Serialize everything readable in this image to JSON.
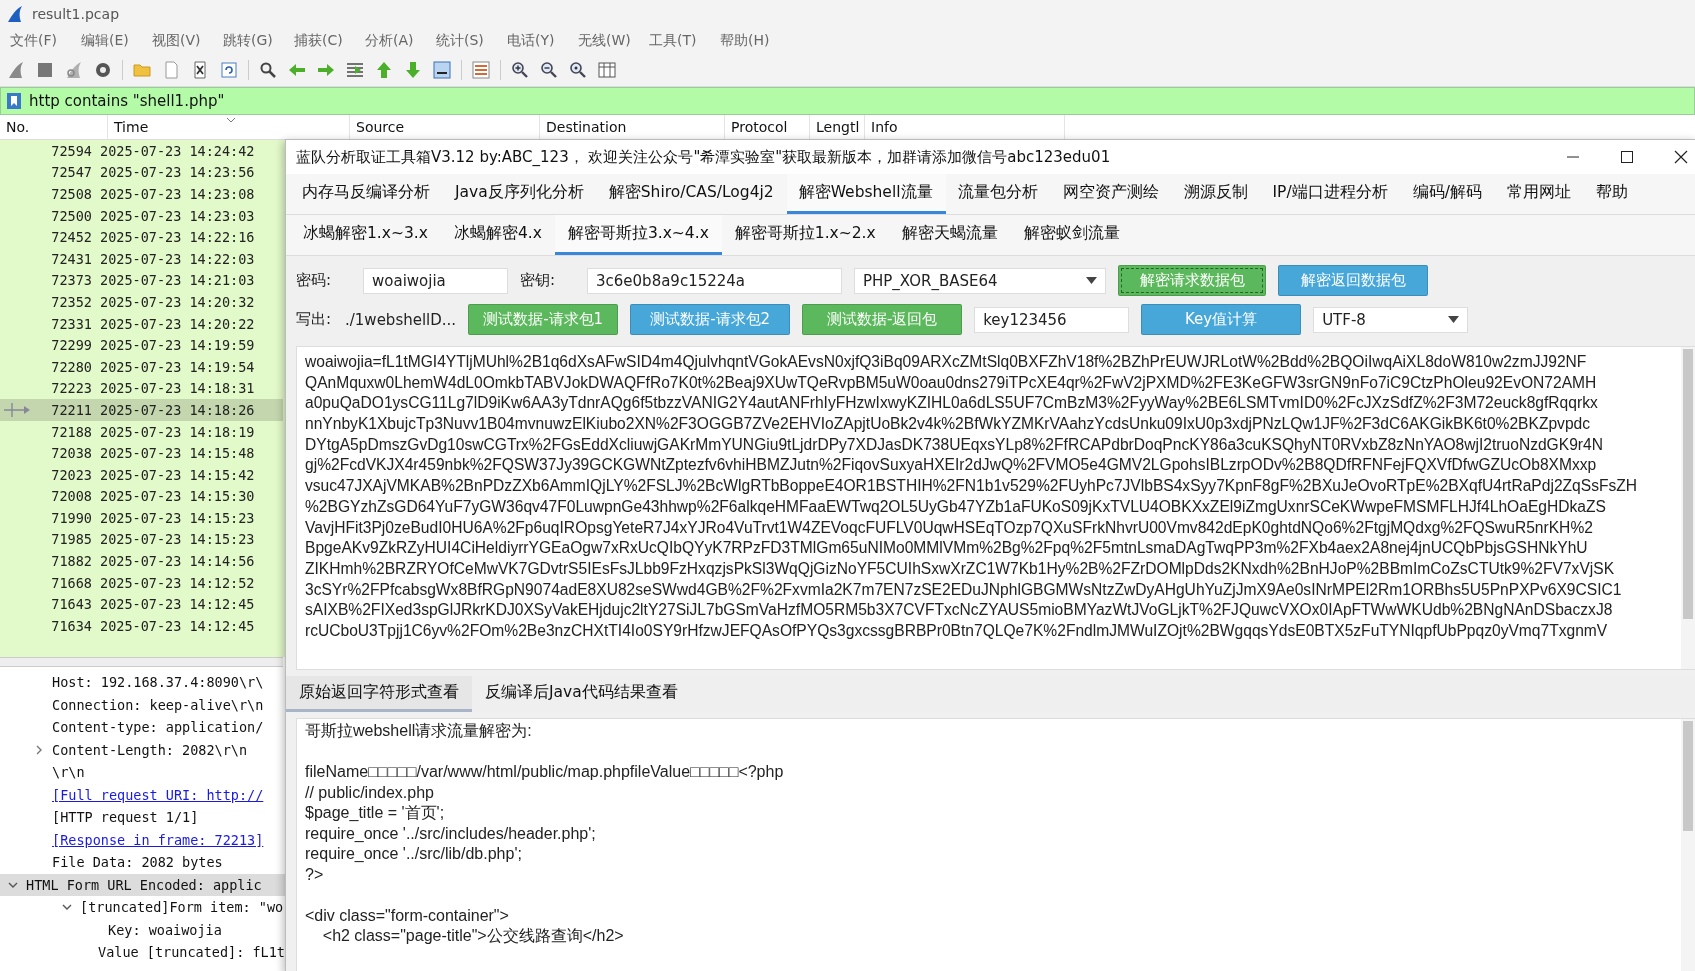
{
  "window": {
    "title": "result1.pcap"
  },
  "menu": [
    "文件(F)",
    "编辑(E)",
    "视图(V)",
    "跳转(G)",
    "捕获(C)",
    "分析(A)",
    "统计(S)",
    "电话(Y)",
    "无线(W)",
    "工具(T)",
    "帮助(H)"
  ],
  "display_filter": {
    "value": "http contains \"shell1.php\""
  },
  "packet_list": {
    "columns": [
      "No.",
      "Time",
      "Source",
      "Destination",
      "Protocol",
      "Lengtl",
      "Info"
    ],
    "rows": [
      {
        "no": "72594",
        "time": "2025-07-23 14:24:42",
        "selected": false
      },
      {
        "no": "72547",
        "time": "2025-07-23 14:23:56",
        "selected": false
      },
      {
        "no": "72508",
        "time": "2025-07-23 14:23:08",
        "selected": false
      },
      {
        "no": "72500",
        "time": "2025-07-23 14:23:03",
        "selected": false
      },
      {
        "no": "72452",
        "time": "2025-07-23 14:22:16",
        "selected": false
      },
      {
        "no": "72431",
        "time": "2025-07-23 14:22:03",
        "selected": false
      },
      {
        "no": "72373",
        "time": "2025-07-23 14:21:03",
        "selected": false
      },
      {
        "no": "72352",
        "time": "2025-07-23 14:20:32",
        "selected": false
      },
      {
        "no": "72331",
        "time": "2025-07-23 14:20:22",
        "selected": false
      },
      {
        "no": "72299",
        "time": "2025-07-23 14:19:59",
        "selected": false
      },
      {
        "no": "72280",
        "time": "2025-07-23 14:19:54",
        "selected": false
      },
      {
        "no": "72223",
        "time": "2025-07-23 14:18:31",
        "selected": false
      },
      {
        "no": "72211",
        "time": "2025-07-23 14:18:26",
        "selected": true
      },
      {
        "no": "72188",
        "time": "2025-07-23 14:18:19",
        "selected": false
      },
      {
        "no": "72038",
        "time": "2025-07-23 14:15:48",
        "selected": false
      },
      {
        "no": "72023",
        "time": "2025-07-23 14:15:42",
        "selected": false
      },
      {
        "no": "72008",
        "time": "2025-07-23 14:15:30",
        "selected": false
      },
      {
        "no": "71990",
        "time": "2025-07-23 14:15:23",
        "selected": false
      },
      {
        "no": "71985",
        "time": "2025-07-23 14:15:23",
        "selected": false
      },
      {
        "no": "71882",
        "time": "2025-07-23 14:14:56",
        "selected": false
      },
      {
        "no": "71668",
        "time": "2025-07-23 14:12:52",
        "selected": false
      },
      {
        "no": "71643",
        "time": "2025-07-23 14:12:45",
        "selected": false
      },
      {
        "no": "71634",
        "time": "2025-07-23 14:12:45",
        "selected": false
      }
    ]
  },
  "packet_details": [
    {
      "text": "Host: 192.168.37.4:8090\\r\\",
      "kind": "field",
      "selected": false
    },
    {
      "text": "Connection: keep-alive\\r\\n",
      "kind": "field",
      "selected": false
    },
    {
      "text": "Content-type: application/",
      "kind": "field",
      "selected": false
    },
    {
      "text": "Content-Length: 2082\\r\\n",
      "kind": "field",
      "selected": false,
      "expanded": false
    },
    {
      "text": "\\r\\n",
      "kind": "field",
      "selected": false
    },
    {
      "text": "[Full request URI: http://",
      "kind": "link",
      "selected": false
    },
    {
      "text": "[HTTP request 1/1]",
      "kind": "field",
      "selected": false
    },
    {
      "text": "[Response in frame: 72213]",
      "kind": "link",
      "selected": false
    },
    {
      "text": "File Data: 2082 bytes",
      "kind": "field",
      "selected": false
    },
    {
      "text": "HTML Form URL Encoded: applic",
      "kind": "section",
      "selected": true,
      "expanded": true,
      "children": [
        {
          "text": "[truncated]Form item: \"wo",
          "selected": false,
          "expanded": true,
          "children": [
            {
              "text": "Key: woaiwojia",
              "selected": false
            },
            {
              "text": "Value [truncated]: fL1t",
              "selected": false
            }
          ]
        }
      ]
    }
  ],
  "tool_window": {
    "title": "蓝队分析取证工具箱V3.12 by:ABC_123， 欢迎关注公众号\"希潭实验室\"获取最新版本，加群请添加微信号abc123edu01",
    "tabs": [
      {
        "label": "内存马反编译分析",
        "selected": false
      },
      {
        "label": "Java反序列化分析",
        "selected": false
      },
      {
        "label": "解密Shiro/CAS/Log4j2",
        "selected": false
      },
      {
        "label": "解密Webshell流量",
        "selected": true
      },
      {
        "label": "流量包分析",
        "selected": false
      },
      {
        "label": "网空资产测绘",
        "selected": false
      },
      {
        "label": "溯源反制",
        "selected": false
      },
      {
        "label": "IP/端口进程分析",
        "selected": false
      },
      {
        "label": "编码/解码",
        "selected": false
      },
      {
        "label": "常用网址",
        "selected": false
      },
      {
        "label": "帮助",
        "selected": false
      }
    ],
    "subtabs": [
      {
        "label": "冰蝎解密1.x~3.x",
        "selected": false
      },
      {
        "label": "冰蝎解密4.x",
        "selected": false
      },
      {
        "label": "解密哥斯拉3.x~4.x",
        "selected": true
      },
      {
        "label": "解密哥斯拉1.x~2.x",
        "selected": false
      },
      {
        "label": "解密天蝎流量",
        "selected": false
      },
      {
        "label": "解密蚁剑流量",
        "selected": false
      }
    ],
    "form_rows": [
      [
        {
          "kind": "label",
          "text": "密码:"
        },
        {
          "kind": "field",
          "value": "woaiwojia"
        },
        {
          "kind": "label",
          "text": "密钥:"
        },
        {
          "kind": "field",
          "value": "3c6e0b8a9c15224a"
        },
        {
          "kind": "dropdown",
          "value": "PHP_XOR_BASE64"
        },
        {
          "kind": "button",
          "label": "解密请求数据包",
          "color": "#5cb85c",
          "focused": true
        },
        {
          "kind": "button",
          "label": "解密返回数据包",
          "color": "#47a7d9",
          "focused": false
        }
      ],
      [
        {
          "kind": "label",
          "text": "写出:"
        },
        {
          "kind": "text",
          "text": "./1webshellD..."
        },
        {
          "kind": "button",
          "label": "测试数据-请求包1",
          "color": "#5cb85c",
          "focused": false
        },
        {
          "kind": "button",
          "label": "测试数据-请求包2",
          "color": "#47a7d9",
          "focused": false
        },
        {
          "kind": "button",
          "label": "测试数据-返回包",
          "color": "#5cb85c",
          "focused": false
        },
        {
          "kind": "field",
          "value": "key123456"
        },
        {
          "kind": "button",
          "label": "Key值计算",
          "color": "#47a7d9",
          "focused": false
        },
        {
          "kind": "dropdown",
          "value": "UTF-8"
        }
      ]
    ],
    "request_lines": [
      "woaiwojia=fL1tMGI4YTljMUhl%2B1q6dXsAFwSID4m4QjulvhqntVGokAEvsN0xjfQ3iBq09ARXcZMtSlq0BXFZhV18f%2BZhPrEUWJRLotW%2Bdd%2BQOiIwqAiXL8doW810w2zmJJ92NF",
      "QAnMquxw0LhemW4dL0OmkbTABVJokDWAQFfRo7K0t%2Beaj9XUwTQeRvpBM5uW0oau0dns279iTPcXE4qr%2FwV2jPXMD%2FE3KeGFW3srGN9nFo7iC9CtzPhOleu92EvON72AMH",
      "a0puQaDO1ysCG11Lg7lD9iKw6AA3yTdnrAQg6f5tbzzVANIG2Y4autANFrhIyFHzwIxwyKZIHL0a6dLS5UF7CmBzM3%2FyyWay%2BE6LSMTvmID0%2FcJXzSdfZ%2F3M72euck8gfRqqrkx",
      "nnYnbyK1XbujcTp3Nuvv1B04mvnuwzElKiubo2XN%2F3OGGB7ZVe2EHVIoZApjtUoBk2v4k%2BfWkYZMKrVAahzYcdsUnku09IxU0p3xdjPNzLQw1JF%2F3dC6AKGikBK6t0%2BKZpvpdc",
      "DYtgA5pDmszGvDg10swCGTrx%2FGsEddXcliuwjGAKrMmYUNGiu9tLjdrDPy7XDJasDK738UEqxsYLp8%2FfRCAPdbrDoqPncKY86a3cuKSQhyNT0RVxbZ8zNnYAO8wjI2truoNzdGK9r4N",
      "gj%2FcdVKJX4r459nbk%2FQSW37Jy39GCKGWNtZptezfv6vhiHBMZJutn%2FiqovSuxyaHXEIr2dJwQ%2FVMO5e4GMV2LGpohsIBLzrpODv%2B8QDfRFNFejFQXVfDfwGZUcOb8XMxxp",
      "vsuc47JXAjVMKAB%2BnPDzZXb6AmmIQjLY%2FSLJ%2BcWlgRTbBoppeE4OR1BSTHIH%2FN1b1v529%2FUyhPc7JVlbBS4xSyy7KpnF8gF%2BXuJeOvoRTpE%2BXqfU4rtRaPdj2ZqSsFsZH",
      "%2BGYzhZsGD64YuF7yGW36qv47F0LuwpnGe43hhwp%2F6alkqeHMFaaEWTwq2OL5UyGb47YZb1aFUKoS09jKxTVLU4OBKXxZEl9iZmgUxnrSCeKWwpeFMSMFLHJf4LhOaEgHDkaZS",
      "VavjHFit3Pj0zeBudI0HU6A%2Fp6uqIROpsgYeteR7J4xYJRo4VuTrvt1W4ZEVoqcFUFLV0UqwHSEqTOzp7QXuSFrkNhvrU00Vmv842dEpK0ghtdNQo6%2FtgjMQdxg%2FQSwuR5nrKH%2",
      "BpgeAKv9ZkRZyHUI4CiHeldiyrrYGEaOgw7xRxUcQIbQYyK7RPzFD3TMlGm65uNIMo0MMlVMm%2Bg%2Fpq%2F5mtnLsmaDAgTwqPP3m%2FXb4aex2A8nej4jnUCQbPbjsGSHNkYhU",
      "ZIKHmh%2BRZRYOfCeMwVK7GDvtrS5IEsFsJLbb9FzHxqzjsPkSl3WqQjGizNoYF5CUIhSxwXrZC1W7Kb1Hy%2B%2FZrDOMlpDds2KNxdh%2BnHJoP%2BBmImCoZsCTUtk9%2FV7xVjSK",
      "3cSYr%2FPfcabsgWx8BfRGpN9074adE8XU82seSWwd4GB%2F%2FxvmIa2K7m7EN7zSE2EDuJNphlGBGMWsNtzZwDyAHgUhYuZjJmX9Ae0sINrMPEl2Rm1ORBhs5U5PnPXPv6X9CSIC1",
      "sAIXB%2FIXed3spGlJRkrKDJ0XSyVakEHjdujc2ltY27SiJL7bGSmVaHzfMO5RM5b3X7CVFTxcNcZYAUS5mioBMYazWtJVoGLjkT%2FJQuwcVXOx0IApFTWwWKUdb%2BNgNAnDSbaczxJ8",
      "rcUCboU3Tpjj1C6yv%2FOm%2Be3nzCHXtTI4Io0SY9rHfzwJEFQAsOfPYQs3gxcssgBRBPr0Btn7QLQe7K%2FndlmJMWuIZOjt%2BWgqqsYdsE0BTX5zFuTYNIqpfUbPpqz0yVmq7TxgnmV"
    ],
    "result_tabs": [
      {
        "label": "原始返回字符形式查看",
        "selected": true
      },
      {
        "label": "反编译后Java代码结果查看",
        "selected": false
      }
    ],
    "result_text": "哥斯拉webshell请求流量解密为:\n\nfileName□□□□□/var/www/html/public/map.phpfileValue□□□□□<?php\n// public/index.php\n$page_title = '首页';\nrequire_once '../src/includes/header.php';\nrequire_once '../src/lib/db.php';\n?>\n\n<div class=\"form-container\">\n    <h2 class=\"page-title\">公交线路查询</h2>"
  }
}
